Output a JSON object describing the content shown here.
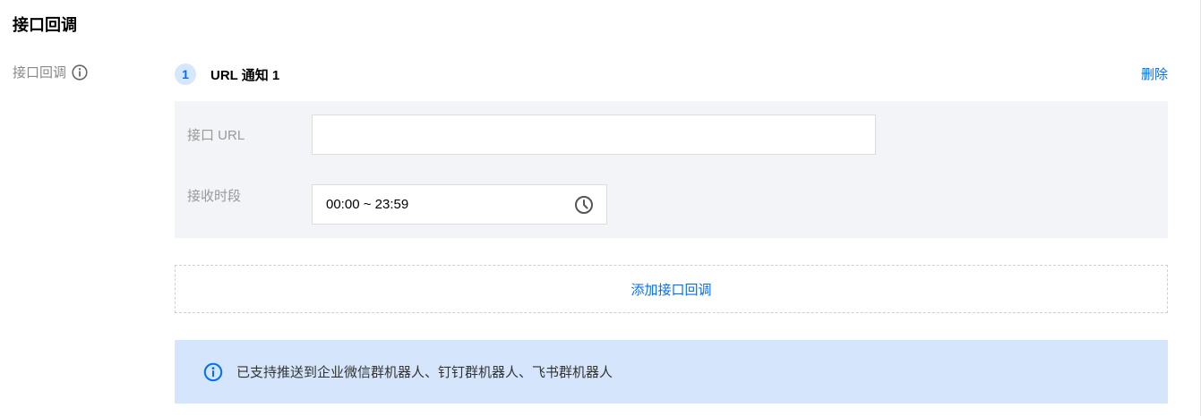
{
  "section": {
    "title": "接口回调"
  },
  "field": {
    "label": "接口回调",
    "info_icon": "info-icon"
  },
  "notify": {
    "index": "1",
    "title": "URL 通知 1",
    "delete_label": "删除",
    "url_label": "接口 URL",
    "url_value": "",
    "time_label": "接收时段",
    "time_value": "00:00 ~ 23:59",
    "time_icon": "clock-icon"
  },
  "add_button": {
    "label": "添加接口回调"
  },
  "banner": {
    "text": "已支持推送到企业微信群机器人、钉钉群机器人、飞书群机器人",
    "icon": "info-icon"
  },
  "colors": {
    "accent": "#006eff",
    "panel_bg": "#f2f4f8",
    "banner_bg": "#d5e5fb"
  }
}
